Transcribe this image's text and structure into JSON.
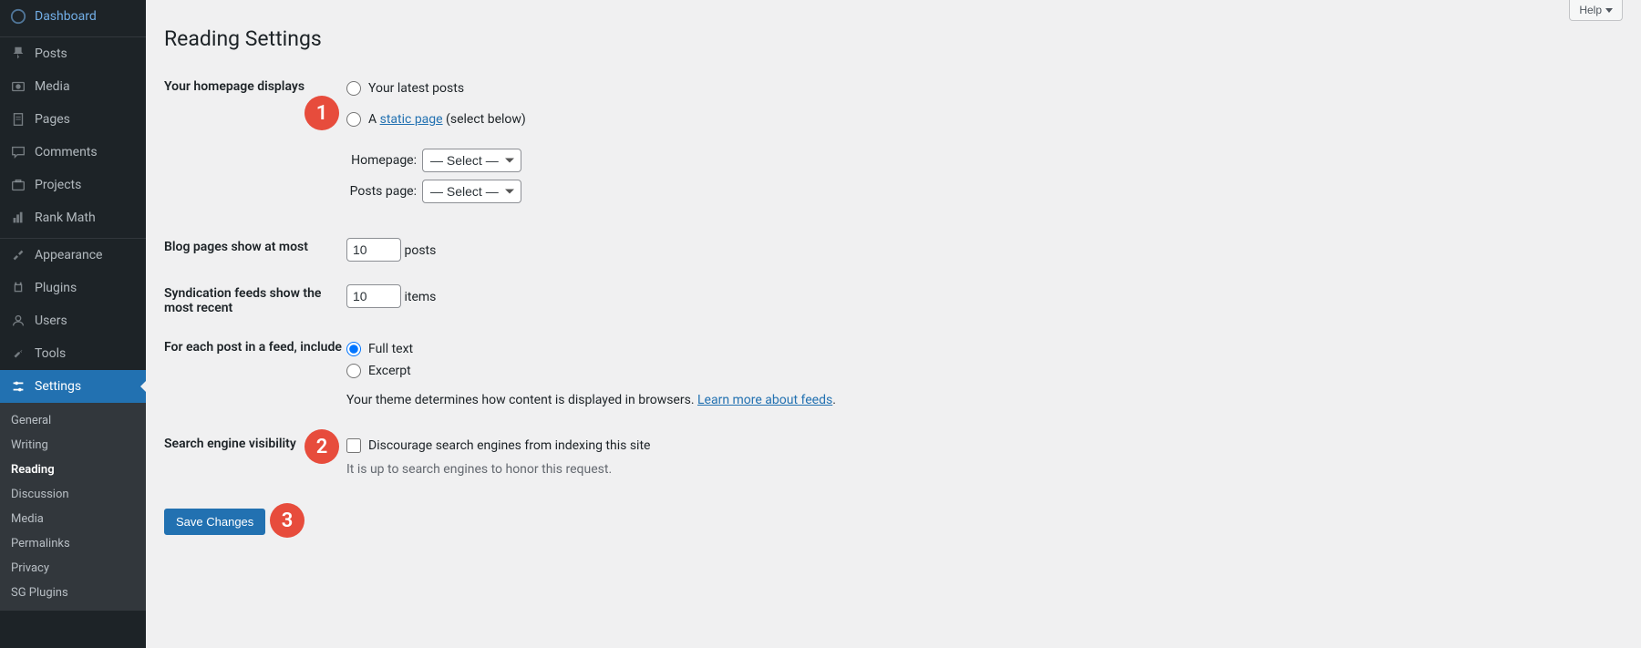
{
  "sidebar": {
    "items": [
      {
        "icon": "dashboard",
        "label": "Dashboard"
      },
      {
        "icon": "pin",
        "label": "Posts"
      },
      {
        "icon": "media",
        "label": "Media"
      },
      {
        "icon": "page",
        "label": "Pages"
      },
      {
        "icon": "comments",
        "label": "Comments"
      },
      {
        "icon": "briefcase",
        "label": "Projects"
      },
      {
        "icon": "rank",
        "label": "Rank Math"
      }
    ],
    "items2": [
      {
        "icon": "brush",
        "label": "Appearance"
      },
      {
        "icon": "plug",
        "label": "Plugins"
      },
      {
        "icon": "users",
        "label": "Users"
      },
      {
        "icon": "tools",
        "label": "Tools"
      },
      {
        "icon": "settings",
        "label": "Settings",
        "current": true
      }
    ],
    "submenu": [
      "General",
      "Writing",
      "Reading",
      "Discussion",
      "Media",
      "Permalinks",
      "Privacy",
      "SG Plugins"
    ],
    "submenu_current_index": 2
  },
  "header": {
    "title": "Reading Settings",
    "help": "Help"
  },
  "homepage": {
    "label": "Your homepage displays",
    "option_latest": "Your latest posts",
    "option_static_prefix": "A ",
    "option_static_link": "static page",
    "option_static_suffix": " (select below)",
    "homepage_label": "Homepage:",
    "posts_page_label": "Posts page:",
    "select_placeholder": "— Select —"
  },
  "blog_pages": {
    "label": "Blog pages show at most",
    "value": "10",
    "suffix": "posts"
  },
  "syndication": {
    "label": "Syndication feeds show the most recent",
    "value": "10",
    "suffix": "items"
  },
  "feed_include": {
    "label": "For each post in a feed, include",
    "option_full": "Full text",
    "option_excerpt": "Excerpt",
    "note_prefix": "Your theme determines how content is displayed in browsers. ",
    "note_link": "Learn more about feeds",
    "note_suffix": "."
  },
  "search_visibility": {
    "label": "Search engine visibility",
    "checkbox_label": "Discourage search engines from indexing this site",
    "note": "It is up to search engines to honor this request."
  },
  "save_button": "Save Changes",
  "callouts": [
    "1",
    "2",
    "3"
  ]
}
